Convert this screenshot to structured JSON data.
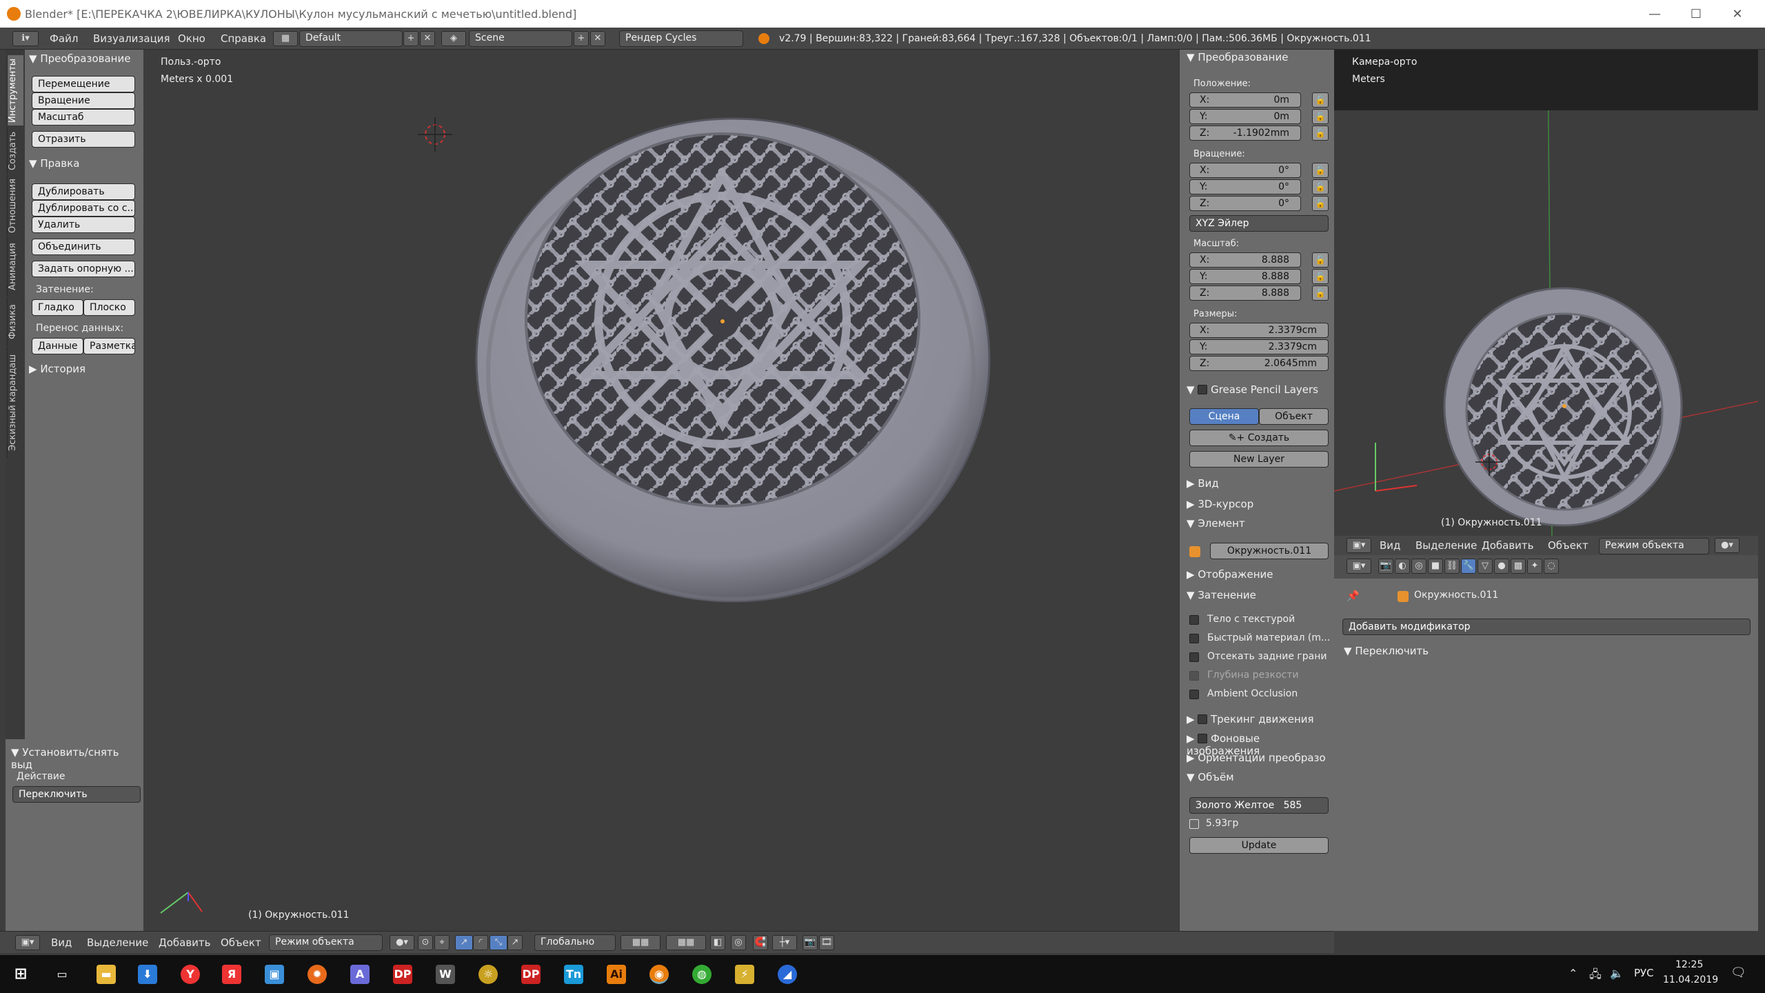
{
  "titlebar": {
    "title": "Blender* [E:\\ПЕРЕКАЧКА 2\\ЮВЕЛИРКА\\КУЛОНЫ\\Кулон мусульманский с мечетью\\untitled.blend]"
  },
  "infobar": {
    "menus": [
      "Файл",
      "Визуализация",
      "Окно",
      "Справка"
    ],
    "layout": "Default",
    "scene": "Scene",
    "engine": "Рендер Cycles",
    "stats": "v2.79 | Вершин:83,322 | Граней:83,664 | Треуг.:167,328 | Объектов:0/1 | Ламп:0/0 | Пам.:506.36МБ | Окружность.011"
  },
  "tabs": [
    "Инструменты",
    "Создать",
    "Отношения",
    "Анимация",
    "Физика",
    "Эскизный карандаш"
  ],
  "toolshelf": {
    "transform_header": "Преобразование",
    "move": "Перемещение",
    "rotate": "Вращение",
    "scale": "Масштаб",
    "mirror": "Отразить",
    "edit_header": "Правка",
    "duplicate": "Дублировать",
    "duplicate_linked": "Дублировать со с...",
    "delete": "Удалить",
    "join": "Объединить",
    "set_origin": "Задать опорную ...",
    "shading_label": "Затенение:",
    "smooth": "Гладко",
    "flat": "Плоско",
    "data_transfer_label": "Перенос данных:",
    "data": "Данные",
    "uvs": "Разметка",
    "history_header": "История",
    "operator_header": "Установить/снять выд",
    "action_label": "Действие",
    "action_value": "Переключить"
  },
  "viewport": {
    "view_name": "Польз.-орто",
    "units": "Meters x 0.001",
    "object_label": "(1) Окружность.011"
  },
  "npanel": {
    "transform_header": "Преобразование",
    "location_label": "Положение:",
    "location": [
      {
        "axis": "X:",
        "value": "0m"
      },
      {
        "axis": "Y:",
        "value": "0m"
      },
      {
        "axis": "Z:",
        "value": "-1.1902mm"
      }
    ],
    "rotation_label": "Вращение:",
    "rotation": [
      {
        "axis": "X:",
        "value": "0°"
      },
      {
        "axis": "Y:",
        "value": "0°"
      },
      {
        "axis": "Z:",
        "value": "0°"
      }
    ],
    "rotation_mode": "XYZ Эйлер",
    "scale_label": "Масштаб:",
    "scale": [
      {
        "axis": "X:",
        "value": "8.888"
      },
      {
        "axis": "Y:",
        "value": "8.888"
      },
      {
        "axis": "Z:",
        "value": "8.888"
      }
    ],
    "dimensions_label": "Размеры:",
    "dimensions": [
      {
        "axis": "X:",
        "value": "2.3379cm"
      },
      {
        "axis": "Y:",
        "value": "2.3379cm"
      },
      {
        "axis": "Z:",
        "value": "2.0645mm"
      }
    ],
    "gp_header": "Grease Pencil Layers",
    "gp_scene": "Сцена",
    "gp_object": "Объект",
    "gp_create": "Создать",
    "gp_newlayer": "New Layer",
    "view_header": "Вид",
    "cursor_header": "3D-курсор",
    "item_header": "Элемент",
    "item_name": "Окружность.011",
    "display_header": "Отображение",
    "shading_header": "Затенение",
    "shading_options": [
      "Тело с текстурой",
      "Быстрый материал (m...",
      "Отсекать задние грани",
      "Глубина резкости",
      "Ambient Occlusion"
    ],
    "tracking_header": "Трекинг движения",
    "bgimages_header": "Фоновые изображения",
    "orient_header": "Ориентации преобразо",
    "volume_header": "Объём",
    "material": "Золото Желтое",
    "material_value": "585",
    "weight": "5.93гр",
    "update": "Update"
  },
  "camview": {
    "view_name": "Камера-орто",
    "units": "Meters",
    "object_label": "(1) Окружность.011"
  },
  "camheader": {
    "menus": [
      "Вид",
      "Выделение",
      "Добавить",
      "Объект"
    ],
    "mode": "Режим объекта"
  },
  "props": {
    "object_name": "Окружность.011",
    "add_modifier": "Добавить модификатор",
    "toggle_header": "Переключить"
  },
  "bottombar": {
    "menus": [
      "Вид",
      "Выделение",
      "Добавить",
      "Объект"
    ],
    "mode": "Режим объекта",
    "orientation": "Глобально"
  },
  "taskbar": {
    "lang": "РУС",
    "time": "12:25",
    "date": "11.04.2019"
  },
  "colors": {
    "panel": "#6b6b6b",
    "viewport": "#3d3d3d",
    "selected_blue": "#5680c2",
    "button": "#e3e3e3",
    "accent_orange": "#e87d0d"
  }
}
